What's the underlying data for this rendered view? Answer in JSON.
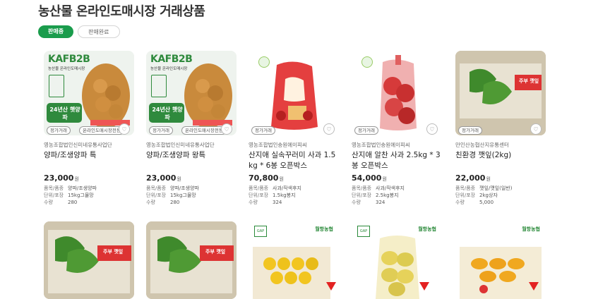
{
  "page": {
    "title": "농산물 온라인도매시장 거래상품"
  },
  "tabs": [
    {
      "label": "판매중",
      "active": true
    },
    {
      "label": "판매완료",
      "active": false
    }
  ],
  "products": [
    {
      "thumb_brand": "KAFB2B",
      "thumb_sub": "농산물 온라인도매시장",
      "thumb_badge": "24년산 햇양파",
      "tag1": "정가거래",
      "tag2": "온라인도매시장전용",
      "seller": "영농조합법인신미네유통사업단",
      "name": "양파/조생양파 특",
      "price": "23,000",
      "unit": "원",
      "meta": [
        {
          "k": "품목/품종",
          "v": "양파/조생양파"
        },
        {
          "k": "단위/포장",
          "v": "15kg그물망"
        },
        {
          "k": "수량",
          "v": "280"
        }
      ]
    },
    {
      "thumb_brand": "KAFB2B",
      "thumb_sub": "농산물 온라인도매시장",
      "thumb_badge": "24년산 햇양파",
      "tag1": "정가거래",
      "tag2": "온라인도매시장전용",
      "seller": "영농조합법인신미네유통사업단",
      "name": "양파/조생양파 왕특",
      "price": "23,000",
      "unit": "원",
      "meta": [
        {
          "k": "품목/품종",
          "v": "양파/조생양파"
        },
        {
          "k": "단위/포장",
          "v": "15kg그물망"
        },
        {
          "k": "수량",
          "v": "280"
        }
      ]
    },
    {
      "tag1": "정가거래",
      "seller": "영농조합법인송원에이피씨",
      "name": "산지애 실속꾸러미 사과 1.5 kg * 6봉 오픈박스",
      "price": "70,800",
      "unit": "원",
      "meta": [
        {
          "k": "품목/품종",
          "v": "사과/작색후지"
        },
        {
          "k": "단위/포장",
          "v": "1.5kg봉지"
        },
        {
          "k": "수량",
          "v": "324"
        }
      ]
    },
    {
      "tag1": "정가거래",
      "seller": "영농조합법인송원에이피씨",
      "name": "산지애 알찬 사과 2.5kg * 3 봉 오픈박스",
      "price": "54,000",
      "unit": "원",
      "meta": [
        {
          "k": "품목/품종",
          "v": "사과/작색후지"
        },
        {
          "k": "단위/포장",
          "v": "2.5kg봉지"
        },
        {
          "k": "수량",
          "v": "324"
        }
      ]
    },
    {
      "thumb_label": "주부 깻잎",
      "tag1": "정가거래",
      "seller": "만인산농협산지유통센터",
      "name": "친환경 깻잎(2kg)",
      "price": "22,000",
      "unit": "원",
      "meta": [
        {
          "k": "품목/품종",
          "v": "깻잎/깻잎(일반)"
        },
        {
          "k": "단위/포장",
          "v": "2kg상자"
        },
        {
          "k": "수량",
          "v": "5,000"
        }
      ]
    }
  ],
  "row2": [
    {
      "label": "주부 깻잎"
    },
    {
      "label": "주부 깻잎"
    },
    {
      "label": "월항농협",
      "mark": "GAP"
    },
    {
      "label": "월항농협",
      "mark": "GAP"
    },
    {
      "label": "월항농협"
    }
  ],
  "colors": {
    "accent": "#1a9c4c",
    "brand_green": "#2f8a3d",
    "discount": "#e32222"
  }
}
